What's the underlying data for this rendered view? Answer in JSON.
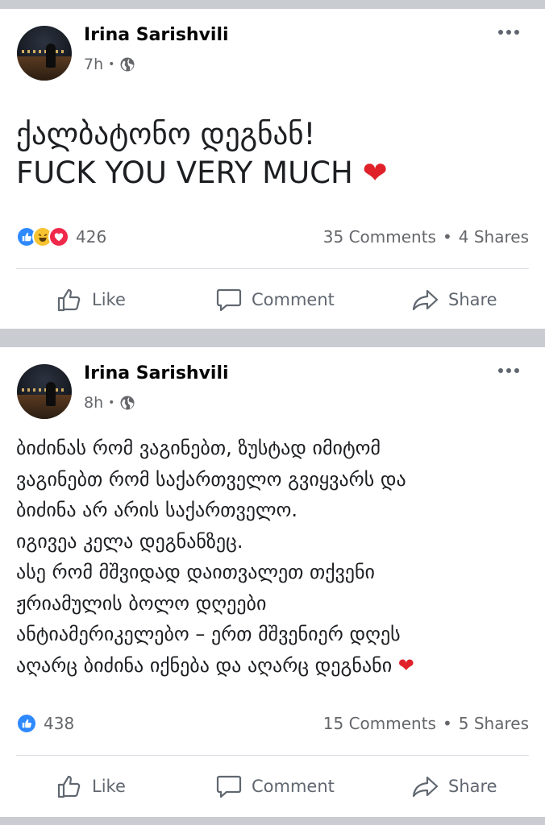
{
  "posts": [
    {
      "author": "Irina Sarishvili",
      "time": "7h",
      "separator": "•",
      "text": "ქალბატონო დეგნან!\nFUCK YOU VERY MUCH",
      "emoji": "❤",
      "reaction_count": "426",
      "comments": "35 Comments",
      "shares": "4 Shares",
      "reactions": [
        "like",
        "haha",
        "love"
      ]
    },
    {
      "author": "Irina Sarishvili",
      "time": "8h",
      "separator": "•",
      "text": "ბიძინას რომ ვაგინებთ, ზუსტად იმიტომ\nვაგინებთ რომ საქართველო გვიყვარს და\nბიძინა  არ არის საქართველო.\nიგივეა კელა დეგნანზეც.\nასე რომ მშვიდად დაითვალეთ თქვენი\nჟრიამულის ბოლო დღეები\nანტიამერიკელებო – ერთ მშვენიერ დღეს\nაღარც ბიძინა იქნება და აღარც დეგნანი",
      "emoji": "❤",
      "reaction_count": "438",
      "comments": "15 Comments",
      "shares": "5 Shares",
      "reactions": [
        "like"
      ]
    }
  ],
  "actions": {
    "like": "Like",
    "comment": "Comment",
    "share": "Share"
  },
  "stats_separator": "•",
  "icons": [
    "globe-icon",
    "more-options-icon",
    "like-icon",
    "comment-icon",
    "share-icon"
  ],
  "colors": {
    "like_blue": "#2e89ff",
    "love_red": "#f0284a",
    "haha_yellow": "#f7c331",
    "secondary_text": "#65676b"
  }
}
